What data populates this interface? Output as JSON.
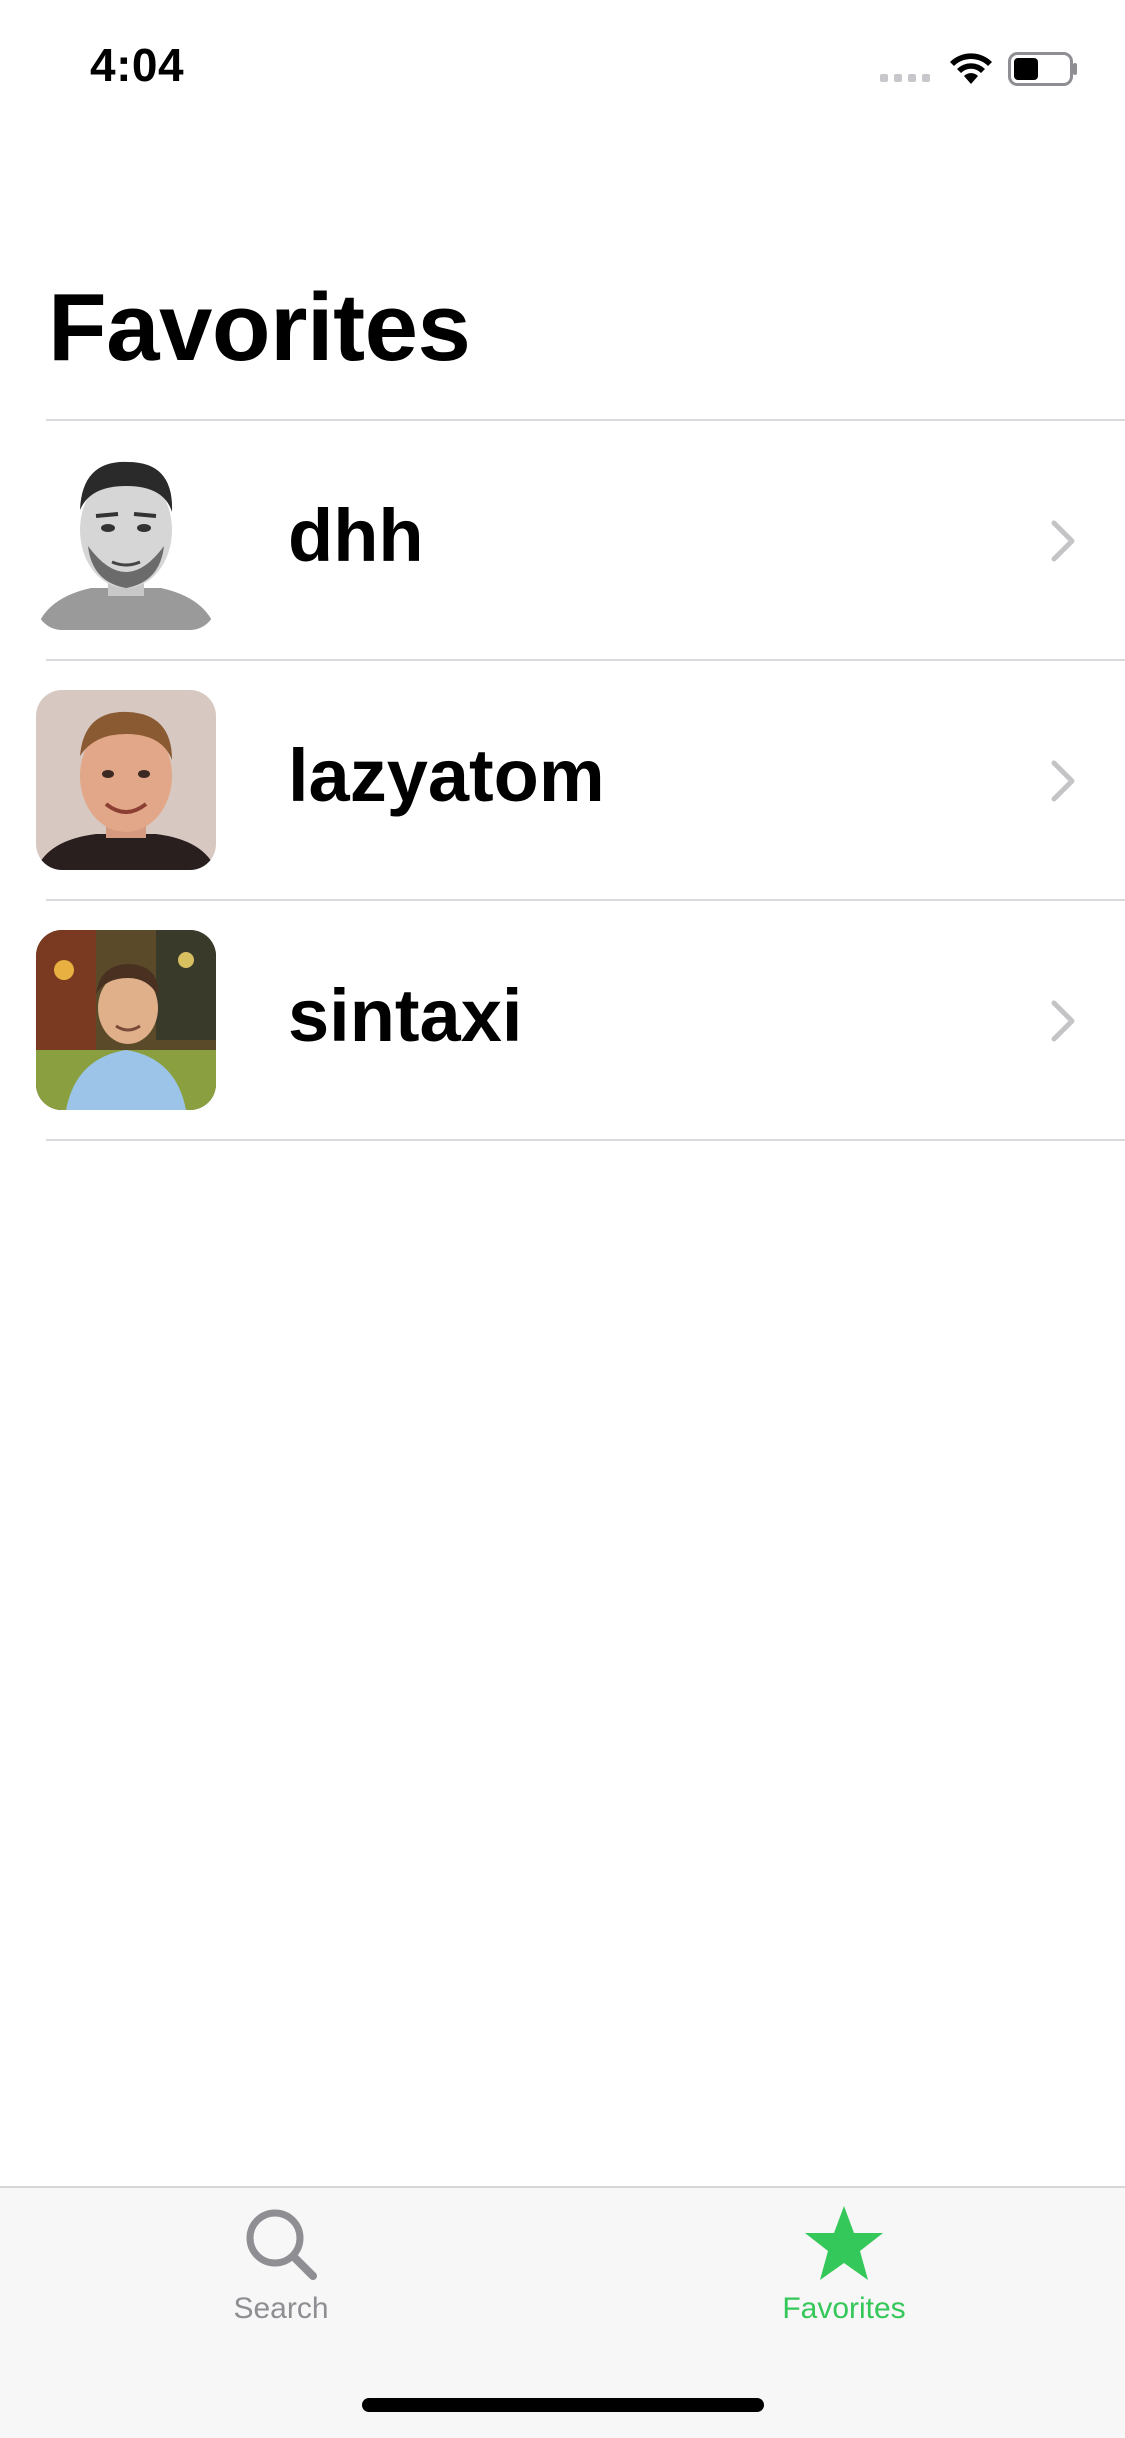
{
  "status_bar": {
    "time": "4:04"
  },
  "title": "Favorites",
  "favorites": [
    {
      "username": "dhh",
      "avatar": "avatar-dhh"
    },
    {
      "username": "lazyatom",
      "avatar": "avatar-lazyatom"
    },
    {
      "username": "sintaxi",
      "avatar": "avatar-sintaxi"
    }
  ],
  "tab_bar": {
    "search_label": "Search",
    "favorites_label": "Favorites",
    "search_icon": "magnifying-glass",
    "favorites_icon": "star",
    "active_color": "#34c759",
    "inactive_color": "#8e8e93"
  }
}
